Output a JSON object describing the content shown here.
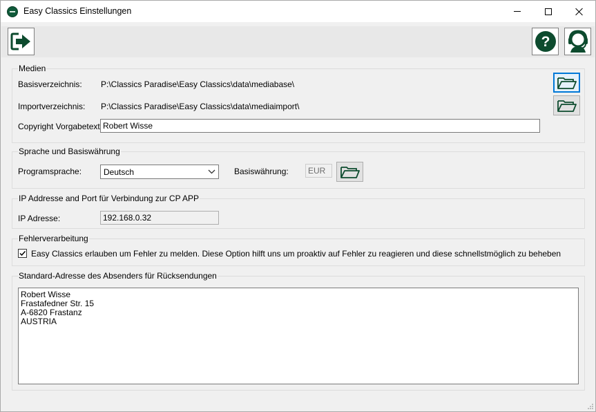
{
  "window": {
    "title": "Easy Classics Einstellungen",
    "icons": {
      "app": "easy-classics-logo-icon",
      "minimize": "minimize-icon",
      "maximize": "maximize-icon",
      "close": "close-icon"
    }
  },
  "toolbar": {
    "exit_icon": "exit-arrow-icon",
    "help_icon": "question-mark-icon",
    "support_icon": "headset-support-icon",
    "accent_color": "#0d4b2e"
  },
  "medien": {
    "group_label": "Medien",
    "basis_label": "Basisverzeichnis:",
    "basis_value": "P:\\Classics Paradise\\Easy Classics\\data\\mediabase\\",
    "import_label": "Importverzeichnis:",
    "import_value": "P:\\Classics Paradise\\Easy Classics\\data\\mediaimport\\",
    "copyright_label": "Copyright Vorgabetext:",
    "copyright_value": "Robert Wisse",
    "folder_icon": "open-folder-icon"
  },
  "sprache": {
    "group_label": "Sprache und Basiswährung",
    "programm_label": "Programsprache:",
    "programm_value": "Deutsch",
    "waehrung_label": "Basiswährung:",
    "waehrung_value": "EUR"
  },
  "ip": {
    "group_label": "IP Addresse and Port für Verbindung zur CP APP",
    "address_label": "IP Adresse:",
    "address_value": "192.168.0.32"
  },
  "fehler": {
    "group_label": "Fehlerverarbeitung",
    "checkbox_checked": true,
    "checkbox_label": "Easy Classics erlauben um Fehler zu melden. Diese Option hilft uns um proaktiv auf Fehler zu reagieren und diese schnellstmöglich zu beheben"
  },
  "adresse": {
    "group_label": "Standard-Adresse des Absenders für Rücksendungen",
    "lines": [
      "Robert Wisse",
      "Frastafedner Str. 15",
      "A-6820 Frastanz",
      "AUSTRIA"
    ]
  }
}
